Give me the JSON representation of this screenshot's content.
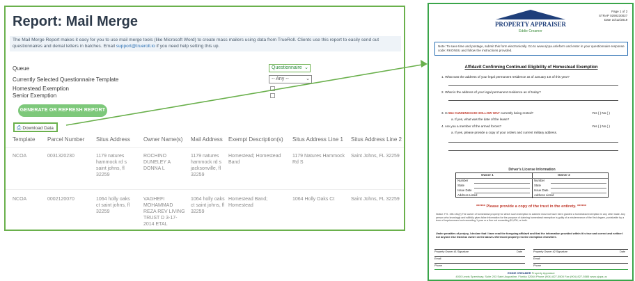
{
  "report": {
    "title": "Report: Mail Merge",
    "description_text": "The Mail Merge Report makes it easy for you to use mail merge tools (like Microsoft Word) to create mass mailers using data from TrueRoll. Clients use this report to easily send out questionnaires and denial letters in batches. Email ",
    "support_email": "support@trueroll.io",
    "description_suffix": " if you need help setting this up.",
    "queue_label": "Queue",
    "queue_value": "Questionnaire",
    "template_label": "Currently Selected Questionnaire Template",
    "template_value": "-- Any --",
    "homestead_label": "Homestead Exemption",
    "senior_label": "Senior Exemption",
    "generate_button": "GENERATE OR REFRESH REPORT",
    "download_label": "Download Data",
    "columns": [
      "Template",
      "Parcel Number",
      "Situs Address",
      "Owner Name(s)",
      "Mail Address",
      "Exempt Description(s)",
      "Situs Address Line 1",
      "Situs Address Line 2"
    ],
    "rows": [
      {
        "template": "NCOA",
        "parcel": "0031320230",
        "situs": "1179 natures hammock rd s saint johns, fl 32259",
        "owner": "ROCHINO DUNELEY A DONNA L",
        "mail": "1179 natures hammock rd s jacksonville, fl 32259",
        "exempt": "Homestead; Homestead Band",
        "line1": "1179 Natures Hammock Rd S",
        "line2": "Saint Johns, FL 32259"
      },
      {
        "template": "NCOA",
        "parcel": "0002120070",
        "situs": "1064 holly oaks ct saint johns, fl 32259",
        "owner": "VAGHEFI MOHAMMAD REZA REV LIVING TRUST D 3-17-2014 ETAL",
        "mail": "1064 holly oaks ct saint johns, fl 32259",
        "exempt": "Homestead Band; Homestead",
        "line1": "1064 Holly Oaks Ct",
        "line2": "Saint Johns, FL 32259"
      }
    ]
  },
  "document": {
    "logo_title": "PROPERTY APPRAISER",
    "logo_sub": "Eddie Creamer",
    "page_info": [
      "Page 1 of 2",
      "STRAP 0290230027",
      "Date 10/12/2019"
    ],
    "note_text": "Note: To save time and postage, submit this form electronically. Go to www.sjcpa.us/eform and enter in your questionnaire response code: RKONSU and follow the instructions provided.",
    "heading": "Affidavit Confirming Continued Eligibility of Homestead Exemption",
    "q1": "1.  What was the address of your legal permanent residence as of January 1st of this year?",
    "q2": "2.  What is the address of your legal permanent residence as of today?",
    "q3_prefix": "3.  Is ",
    "q3_address": "564 CUNNINGHAM HOLLOW WAY",
    "q3_suffix": " currently being rented?",
    "q3a": "a.  If yes, what was the date of the lease?",
    "q4": "4.  Are you a member of the armed forces?",
    "q4a": "a.  If yes, please provide a copy of your orders and current military address.",
    "yes_no": "Yes (  )  No (  )",
    "dl_title": "Driver's License Information",
    "owner1": "Owner 1",
    "owner2": "Owner 2",
    "dl_fields": [
      "Number",
      "State",
      "Issue Date",
      "Address Listed"
    ],
    "trust_note": "****** Please provide a copy of the trust in the entirety. ******",
    "notice_text": "Notice: F.S. 196.131(2) The owner of homestead property for which such exemption is claimed must not have been granted a homestead exemption in any other state. Any person who knowingly and willfully gives false information for the purpose of claiming homestead exemption is guilty of a misdemeanor of the first degree, punishable by a term of imprisonment not exceeding 1 year or a fine not exceeding $1,000, or both.",
    "perjury_text": "Under penalties of perjury, I declare that I have read the foregoing affidavit and that the information provided within it is true and correct and neither I nor anyone else listed as owner on the above-referenced property receive exemption elsewhere.",
    "sig1": "Property Owner #1 Signature",
    "sig2": "Property Owner #2 Signature",
    "date_label": "Date",
    "email_label": "Email",
    "phone_label": "Phone",
    "footer_brand": "EDDIE CREAMER",
    "footer_brand_sub": "Property Appraiser",
    "footer_address": "4030 Lewis Speedway, Suite 203   Saint Augustine, Florida 32084   Phone (904) 827-5500   Fax (904) 827-5585   www.sjcpa.us"
  },
  "colors": {
    "accent_green": "#6ab04c",
    "button_green": "#7dc87a",
    "title_navy": "#2d3a4a",
    "doc_navy": "#1f3f7a",
    "alert_red": "#c0392b"
  }
}
